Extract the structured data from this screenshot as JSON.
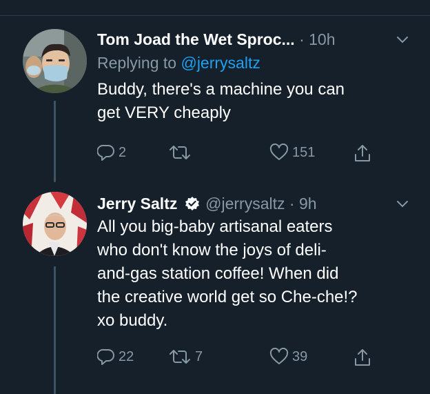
{
  "tweets": [
    {
      "name": "Tom Joad the Wet Sproc...",
      "handle": "",
      "time_sep": "·",
      "time": "10h",
      "reply_prefix": "Replying to",
      "reply_handle": "@jerrysaltz",
      "text_lines": [
        "Buddy, there's a machine you can",
        "get VERY cheaply"
      ],
      "stats": {
        "replies": "2",
        "retweets": "",
        "likes": "151"
      }
    },
    {
      "name": "Jerry Saltz",
      "handle": "@jerrysaltz",
      "time_sep": "·",
      "time": "9h",
      "text_lines": [
        "All you big-baby artisanal eaters",
        "who don't know the joys of deli-",
        "and-gas station coffee! When did",
        "the creative world get so Che-che!?",
        "xo buddy."
      ],
      "stats": {
        "replies": "22",
        "retweets": "7",
        "likes": "39"
      }
    }
  ],
  "icons": {
    "reply": "reply-icon",
    "retweet": "retweet-icon",
    "like": "heart-icon",
    "share": "share-icon",
    "caret": "chevron-down-icon",
    "verified": "verified-badge-icon"
  },
  "colors": {
    "background": "#15202b",
    "muted": "#8899a6",
    "link": "#1da1f2",
    "text": "#ffffff"
  }
}
